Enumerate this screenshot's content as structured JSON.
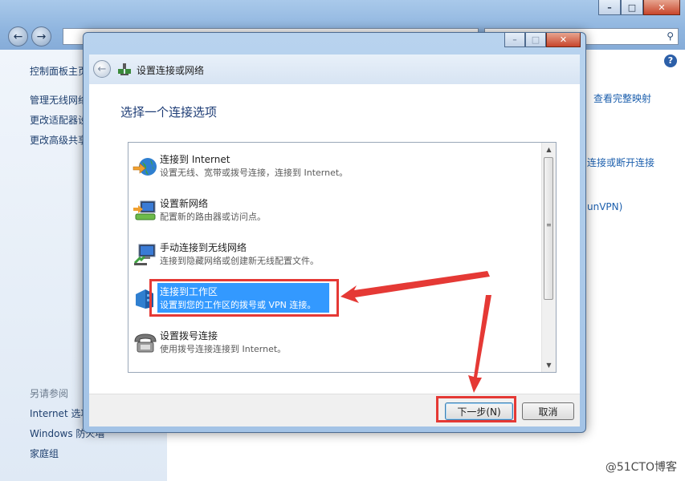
{
  "background_window": {
    "sidebar": {
      "items": [
        "控制面板主页",
        "管理无线网络",
        "更改适配器设置",
        "更改高级共享设置"
      ],
      "see_also_header": "另请参阅",
      "see_also": [
        "Internet 选项",
        "Windows 防火墙",
        "家庭组"
      ]
    },
    "right_links": [
      "查看完整映射",
      "连接或断开连接",
      "unVPN)"
    ],
    "search_icon": "magnifier-icon",
    "help_icon": "question-icon"
  },
  "dialog": {
    "title": "设置连接或网络",
    "heading": "选择一个连接选项",
    "options": [
      {
        "title": "连接到 Internet",
        "desc": "设置无线、宽带或拨号连接，连接到 Internet。",
        "icon": "globe-icon"
      },
      {
        "title": "设置新网络",
        "desc": "配置新的路由器或访问点。",
        "icon": "router-icon"
      },
      {
        "title": "手动连接到无线网络",
        "desc": "连接到隐藏网络或创建新无线配置文件。",
        "icon": "wireless-monitor-icon"
      },
      {
        "title": "连接到工作区",
        "desc": "设置到您的工作区的拨号或 VPN 连接。",
        "icon": "workplace-icon"
      },
      {
        "title": "设置拨号连接",
        "desc": "使用拨号连接连接到 Internet。",
        "icon": "phone-icon"
      }
    ],
    "selected_index": 3,
    "next_button": "下一步(N)",
    "cancel_button": "取消"
  },
  "watermark": "@51CTO博客",
  "colors": {
    "selection": "#3399ff",
    "annotation": "#e53935"
  }
}
